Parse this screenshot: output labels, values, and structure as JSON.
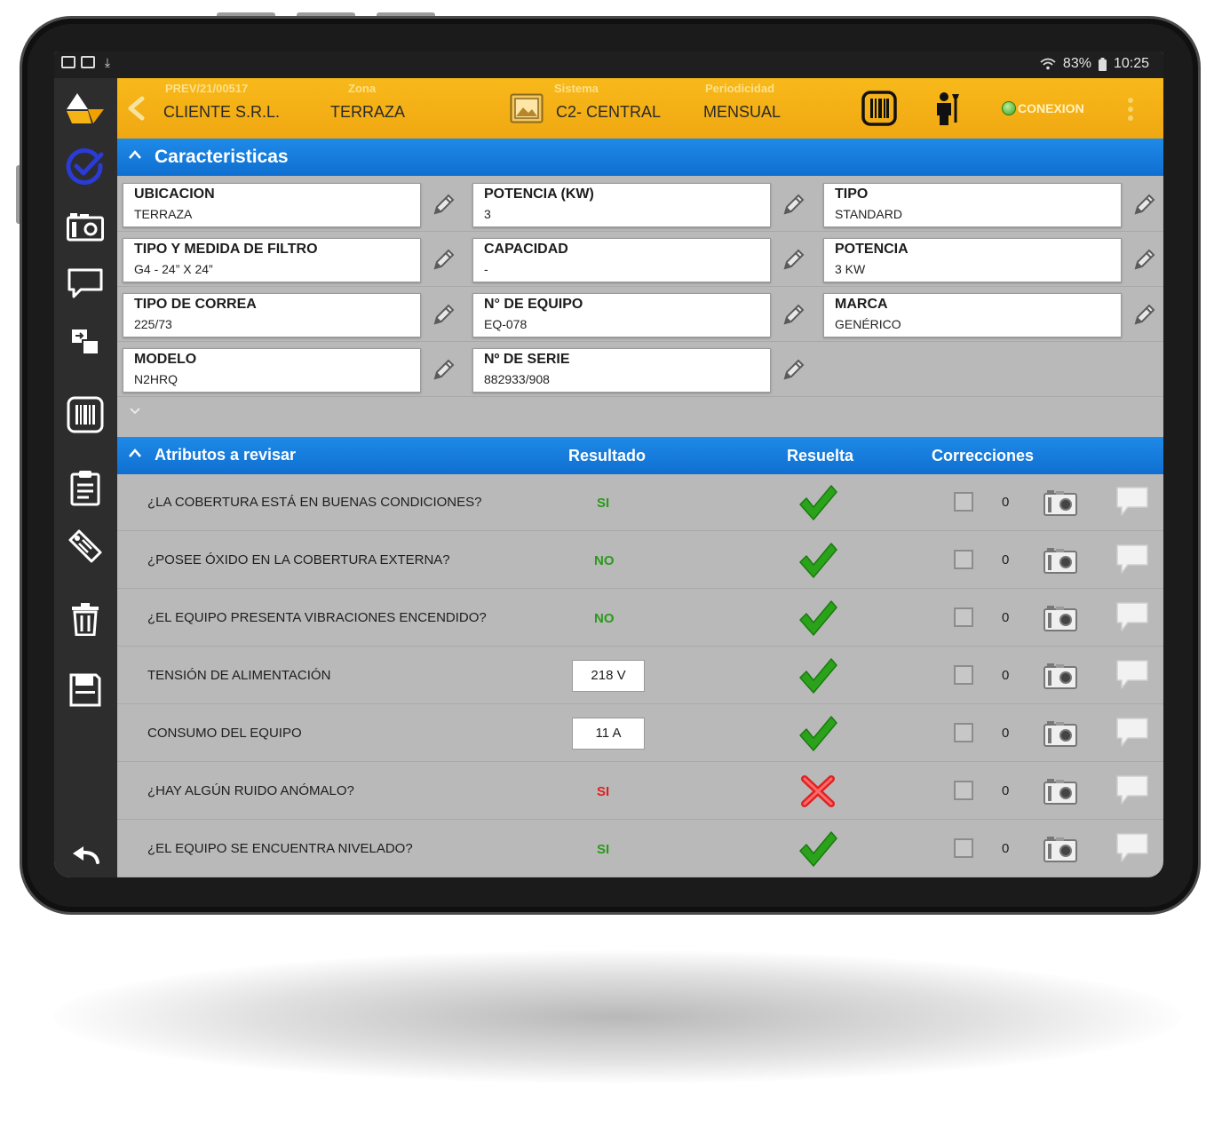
{
  "status_bar": {
    "battery": "83%",
    "time": "10:25"
  },
  "header": {
    "order_number": "PREV/21/00517",
    "client": "CLIENTE S.R.L.",
    "zone_label": "Zona",
    "zone_value": "TERRAZA",
    "system_label": "Sistema",
    "system_value": "C2- CENTRAL",
    "periodicity_label": "Periodicidad",
    "periodicity_value": "MENSUAL",
    "connection_label": "CONEXION"
  },
  "caracteristicas": {
    "title": "Caracteristicas",
    "fields": [
      {
        "label": "UBICACION",
        "value": "TERRAZA"
      },
      {
        "label": "POTENCIA (KW)",
        "value": "3"
      },
      {
        "label": "TIPO",
        "value": "STANDARD"
      },
      {
        "label": "TIPO Y MEDIDA DE FILTRO",
        "value": "G4 - 24” X 24”"
      },
      {
        "label": "CAPACIDAD",
        "value": "-"
      },
      {
        "label": "POTENCIA",
        "value": "3 KW"
      },
      {
        "label": "TIPO DE CORREA",
        "value": "225/73"
      },
      {
        "label": "N° DE EQUIPO",
        "value": "EQ-078"
      },
      {
        "label": "MARCA",
        "value": "GENÉRICO"
      },
      {
        "label": "MODELO",
        "value": "N2HRQ"
      },
      {
        "label": "Nº DE SERIE",
        "value": "882933/908"
      }
    ]
  },
  "atributos": {
    "title": "Atributos a revisar",
    "col_resultado": "Resultado",
    "col_resuelta": "Resuelta",
    "col_correcciones": "Correcciones",
    "rows": [
      {
        "question": "¿LA COBERTURA ESTÁ EN BUENAS CONDICIONES?",
        "result": "SI",
        "result_kind": "text",
        "result_color": "#2a9a1a",
        "resolved": true,
        "count": "0"
      },
      {
        "question": "¿POSEE ÓXIDO EN LA COBERTURA EXTERNA?",
        "result": "NO",
        "result_kind": "text",
        "result_color": "#2a9a1a",
        "resolved": true,
        "count": "0"
      },
      {
        "question": "¿EL EQUIPO PRESENTA VIBRACIONES ENCENDIDO?",
        "result": "NO",
        "result_kind": "text",
        "result_color": "#2a9a1a",
        "resolved": true,
        "count": "0"
      },
      {
        "question": "TENSIÓN DE ALIMENTACIÓN",
        "result": "218 V",
        "result_kind": "box",
        "result_color": "#1e1e1e",
        "resolved": true,
        "count": "0"
      },
      {
        "question": "CONSUMO DEL EQUIPO",
        "result": "11 A",
        "result_kind": "box",
        "result_color": "#1e1e1e",
        "resolved": true,
        "count": "0"
      },
      {
        "question": "¿HAY ALGÚN RUIDO ANÓMALO?",
        "result": "SI",
        "result_kind": "text",
        "result_color": "#e02020",
        "resolved": false,
        "count": "0"
      },
      {
        "question": "¿EL EQUIPO SE ENCUENTRA NIVELADO?",
        "result": "SI",
        "result_kind": "text",
        "result_color": "#2a9a1a",
        "resolved": true,
        "count": "0"
      }
    ]
  },
  "colors": {
    "accent_yellow": "#f5b316",
    "accent_blue": "#1580e0",
    "ok_green": "#2aa31a",
    "error_red": "#e02020"
  },
  "icons": {
    "rail": [
      "app-logo-icon",
      "checklist-done-icon",
      "camera-icon",
      "comment-icon",
      "transfer-icon",
      "barcode-icon",
      "clipboard-icon",
      "tag-icon",
      "trash-icon",
      "save-icon",
      "back-icon"
    ],
    "row": [
      "check-icon",
      "cross-icon",
      "checkbox",
      "camera-icon",
      "comment-icon"
    ]
  }
}
